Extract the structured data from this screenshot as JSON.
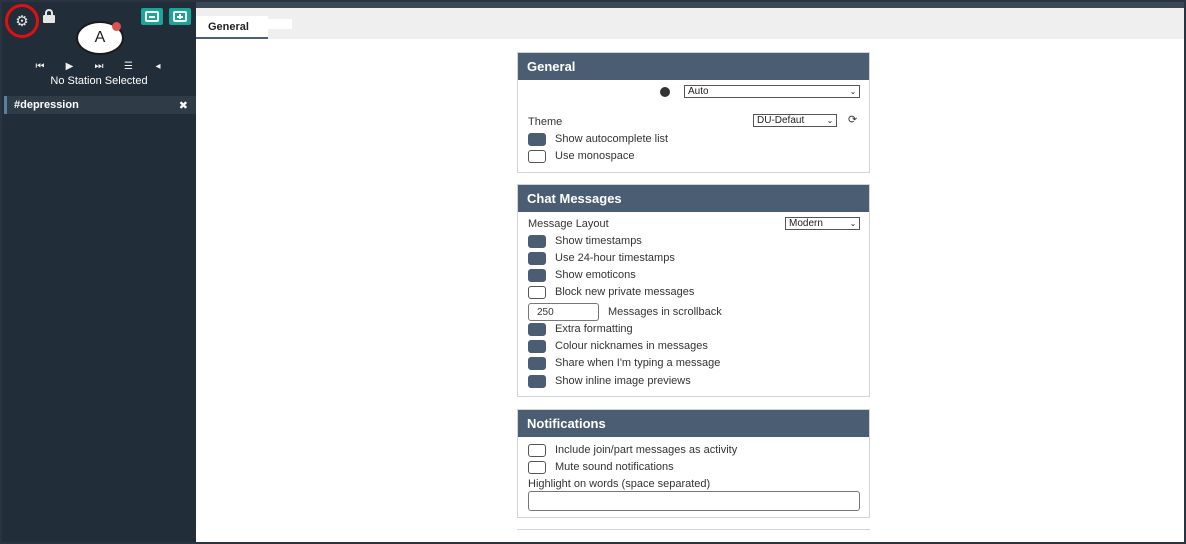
{
  "sidebar": {
    "settings_icon": "gear-icon",
    "lock_icon": "lock-icon",
    "minus_button_icon": "minus-square-icon",
    "plus_button_icon": "plus-square-icon",
    "avatar_letter": "A",
    "station_text": "No Station Selected",
    "controls": [
      "⏮",
      "▶",
      "⏭",
      "☰",
      "◂"
    ],
    "channel": {
      "name": "#depression",
      "close": "✖"
    }
  },
  "tabs": {
    "active": "General"
  },
  "general": {
    "title": "General",
    "language_value": "Auto",
    "theme_label": "Theme",
    "theme_value": "DU-Defaut",
    "show_autocomplete": "Show autocomplete list",
    "use_monospace": "Use monospace"
  },
  "chat": {
    "title": "Chat Messages",
    "layout_label": "Message Layout",
    "layout_value": "Modern",
    "show_timestamps": "Show timestamps",
    "use_24h": "Use 24-hour timestamps",
    "show_emoticons": "Show emoticons",
    "block_private": "Block new private messages",
    "scrollback_value": "250",
    "scrollback_label": "Messages in scrollback",
    "extra_formatting": "Extra formatting",
    "colour_nicknames": "Colour nicknames in messages",
    "share_typing": "Share when I'm typing a message",
    "inline_images": "Show inline image previews"
  },
  "notifications": {
    "title": "Notifications",
    "join_part": "Include join/part messages as activity",
    "mute_sound": "Mute sound notifications",
    "highlight_label": "Highlight on words (space separated)",
    "highlight_value": ""
  },
  "colors": {
    "sidebar_bg": "#212d38",
    "panel_header": "#4b5d72",
    "accent_teal": "#1aa59a",
    "alert_red": "#e01010"
  }
}
